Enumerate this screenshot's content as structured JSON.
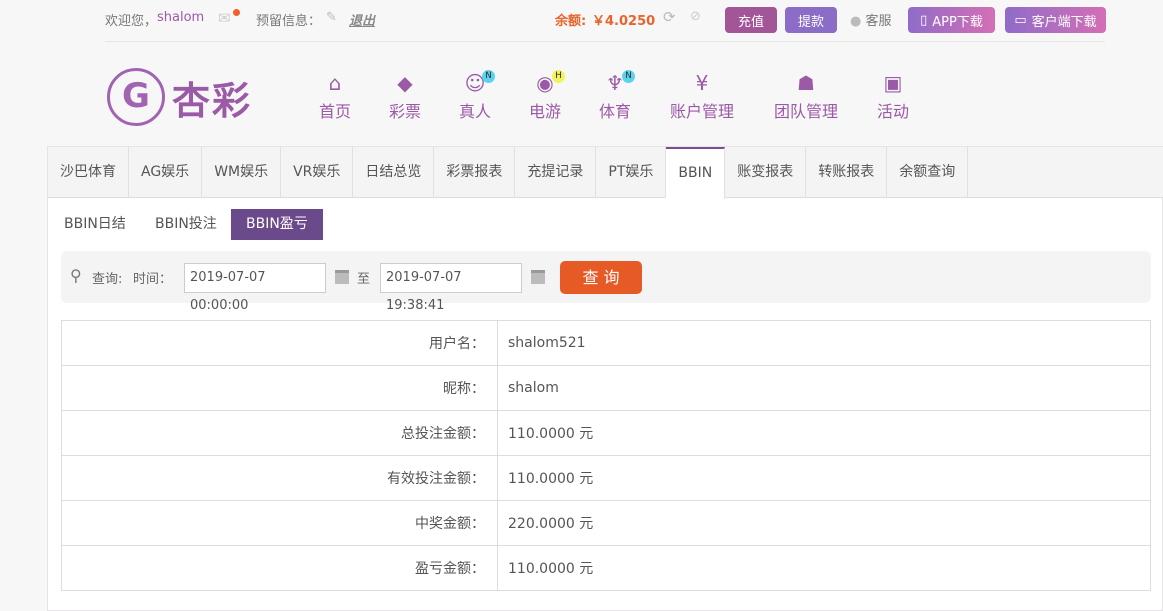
{
  "topbar": {
    "welcome": "欢迎您，",
    "username": "shalom",
    "reserved_label": "预留信息：",
    "logout": "退出",
    "balance_label": "余额:",
    "balance": "￥4.0250",
    "deposit": "充值",
    "withdraw": "提款",
    "support": "客服",
    "app_download": "APP下载",
    "client_download": "客户端下载"
  },
  "logo": {
    "text": "杏彩"
  },
  "nav": [
    {
      "label": "首页",
      "icon": "home-icon"
    },
    {
      "label": "彩票",
      "icon": "ticket-icon"
    },
    {
      "label": "真人",
      "icon": "dealer-icon",
      "badge": "N"
    },
    {
      "label": "电游",
      "icon": "gamepad-icon",
      "badge": "H"
    },
    {
      "label": "体育",
      "icon": "trophy-icon",
      "badge": "N"
    },
    {
      "label": "账户管理",
      "icon": "yen-icon"
    },
    {
      "label": "团队管理",
      "icon": "team-icon"
    },
    {
      "label": "活动",
      "icon": "gift-icon"
    }
  ],
  "tabs": [
    "沙巴体育",
    "AG娱乐",
    "WM娱乐",
    "VR娱乐",
    "日结总览",
    "彩票报表",
    "充提记录",
    "PT娱乐",
    "BBIN",
    "账变报表",
    "转账报表",
    "余额查询"
  ],
  "active_tab": "BBIN",
  "subtabs": [
    "BBIN日结",
    "BBIN投注",
    "BBIN盈亏"
  ],
  "search": {
    "label": "查询:",
    "time_label": "时间：",
    "start": "2019-07-07 00:00:00",
    "to": "至",
    "end": "2019-07-07 19:38:41",
    "button": "查 询"
  },
  "rows": [
    {
      "label": "用户名：",
      "value": "shalom521"
    },
    {
      "label": "昵称：",
      "value": "shalom"
    },
    {
      "label": "总投注金额：",
      "value": "110.0000 元"
    },
    {
      "label": "有效投注金额：",
      "value": "110.0000 元"
    },
    {
      "label": "中奖金额：",
      "value": "220.0000 元"
    },
    {
      "label": "盈亏金额：",
      "value": "110.0000 元"
    }
  ],
  "colors": {
    "brand": "#9b5aa5",
    "balance": "#e8642c",
    "query_button": "#e65a25"
  }
}
